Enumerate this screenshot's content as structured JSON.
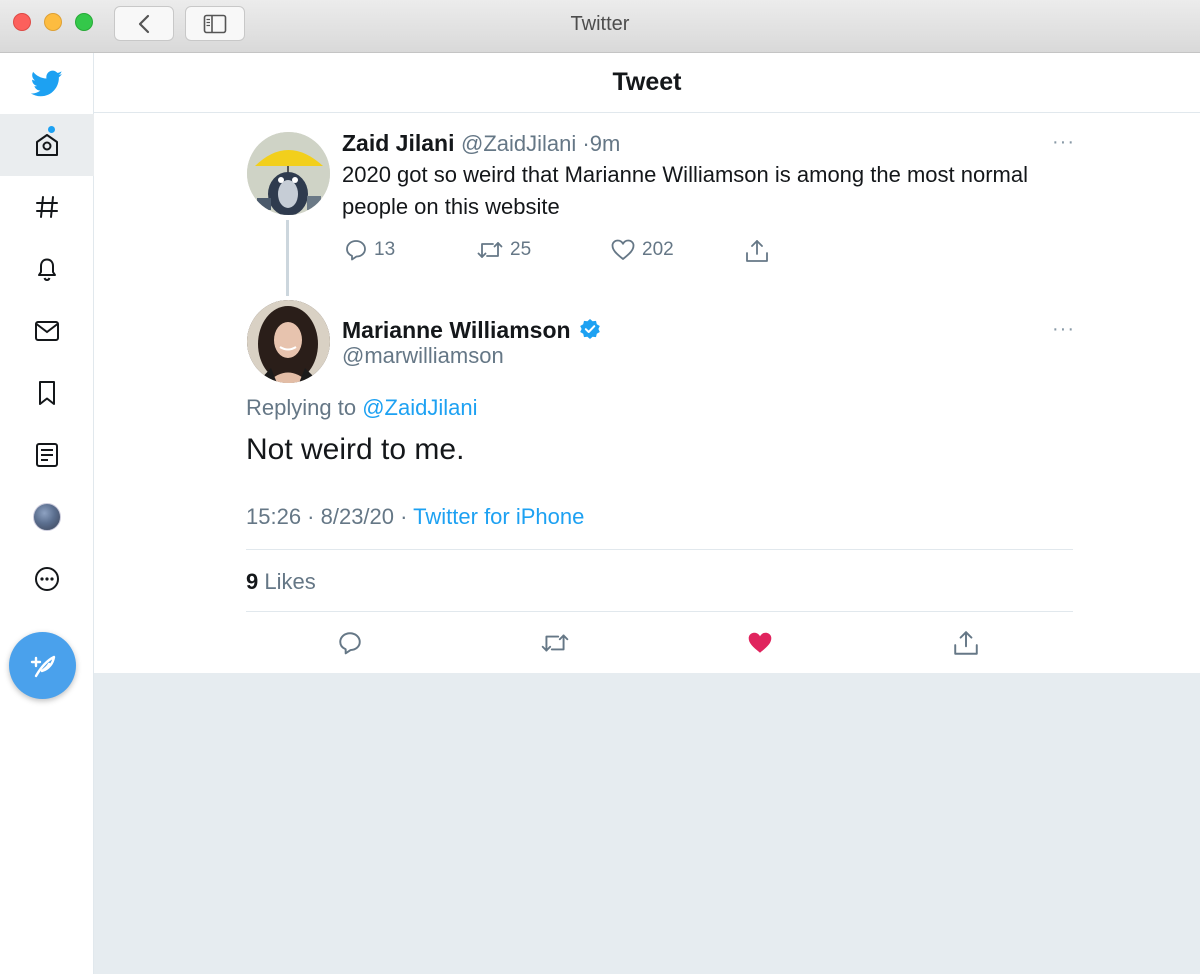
{
  "window": {
    "title": "Twitter"
  },
  "header": {
    "title": "Tweet"
  },
  "parent_tweet": {
    "name": "Zaid Jilani",
    "handle": "@ZaidJilani",
    "separator": "·",
    "time": "9m",
    "text": "2020 got so weird that Marianne Williamson is among the most normal people on this website",
    "replies": "13",
    "retweets": "25",
    "likes": "202",
    "more": "···"
  },
  "main_tweet": {
    "name": "Marianne Williamson",
    "handle": "@marwilliamson",
    "verified": true,
    "replying_prefix": "Replying to",
    "replying_to": "@ZaidJilani",
    "text": "Not weird to me.",
    "timestamp": "15:26 · 8/23/20 ·",
    "source": "Twitter for iPhone",
    "likes_count": "9",
    "likes_label": "Likes",
    "liked": true,
    "more": "···"
  },
  "colors": {
    "accent": "#1da1f2",
    "like": "#e0245e",
    "compose": "#4aa1ec"
  },
  "sidebar": {
    "items": [
      {
        "name": "twitter-logo-icon"
      },
      {
        "name": "home-icon",
        "active": true
      },
      {
        "name": "hashtag-icon"
      },
      {
        "name": "bell-icon"
      },
      {
        "name": "mail-icon"
      },
      {
        "name": "bookmark-icon"
      },
      {
        "name": "list-icon"
      },
      {
        "name": "profile-avatar"
      },
      {
        "name": "more-icon"
      },
      {
        "name": "compose-icon"
      }
    ]
  }
}
